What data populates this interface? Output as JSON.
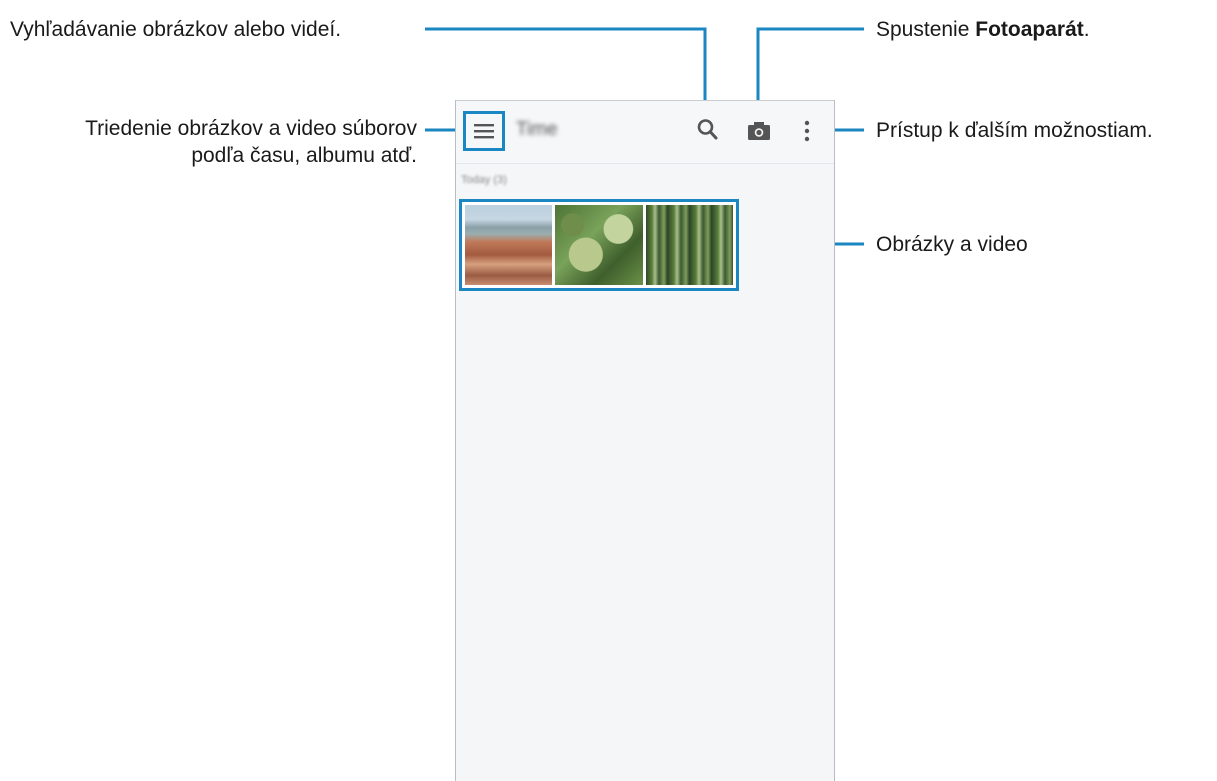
{
  "callouts": {
    "search": "Vyhľadávanie obrázkov alebo videí.",
    "sort_line1": "Triedenie obrázkov a video súborov",
    "sort_line2": "podľa času, albumu atď.",
    "camera_prefix": "Spustenie ",
    "camera_bold": "Fotoaparát",
    "camera_suffix": ".",
    "more": "Prístup k ďalším možnostiam.",
    "media": "Obrázky a video"
  },
  "app": {
    "title": "Time",
    "date_header": "Today (3)",
    "icons": [
      "menu-icon",
      "search-icon",
      "camera-icon",
      "more-vertical-icon"
    ],
    "thumbnails": [
      "city-rooftops",
      "green-flower-buds",
      "tree-trunks"
    ]
  },
  "colors": {
    "accent": "#1a86c2",
    "screen_bg": "#f4f6f8",
    "text": "#1a1a1a"
  }
}
